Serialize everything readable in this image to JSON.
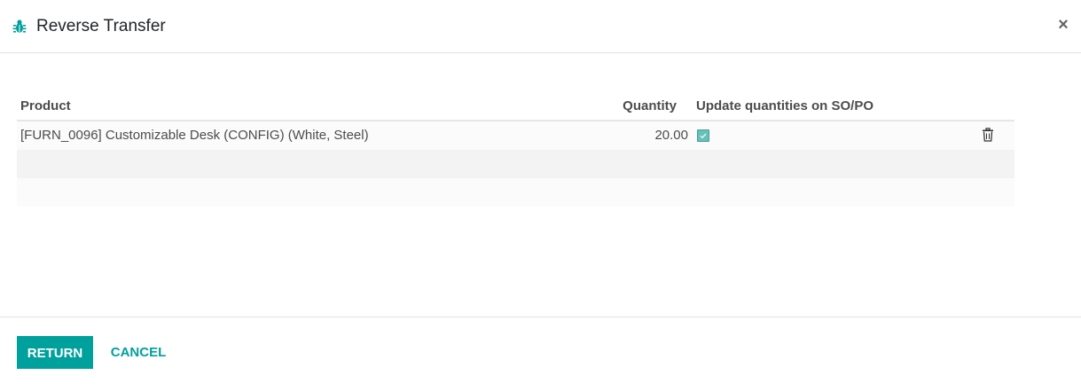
{
  "dialog": {
    "title": "Reverse Transfer",
    "title_icon": "bug-icon",
    "close_label": "×"
  },
  "table": {
    "columns": {
      "product": "Product",
      "quantity": "Quantity",
      "update": "Update quantities on SO/PO"
    },
    "rows": [
      {
        "product": "[FURN_0096] Customizable Desk (CONFIG) (White, Steel)",
        "quantity": "20.00",
        "update_checked": true
      }
    ]
  },
  "footer": {
    "return_label": "RETURN",
    "cancel_label": "CANCEL"
  },
  "colors": {
    "accent": "#00a09d",
    "checkbox": "#66c1b9"
  }
}
